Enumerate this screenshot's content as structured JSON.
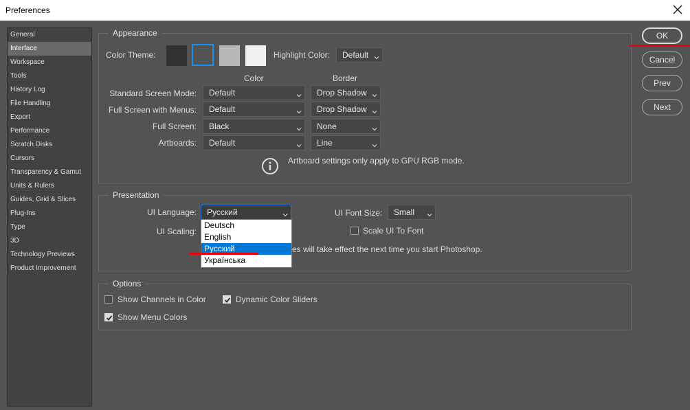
{
  "window": {
    "title": "Preferences"
  },
  "sidebar": {
    "items": [
      {
        "label": "General"
      },
      {
        "label": "Interface",
        "selected": true
      },
      {
        "label": "Workspace"
      },
      {
        "label": "Tools"
      },
      {
        "label": "History Log"
      },
      {
        "label": "File Handling"
      },
      {
        "label": "Export"
      },
      {
        "label": "Performance"
      },
      {
        "label": "Scratch Disks"
      },
      {
        "label": "Cursors"
      },
      {
        "label": "Transparency & Gamut"
      },
      {
        "label": "Units & Rulers"
      },
      {
        "label": "Guides, Grid & Slices"
      },
      {
        "label": "Plug-Ins"
      },
      {
        "label": "Type"
      },
      {
        "label": "3D"
      },
      {
        "label": "Technology Previews"
      },
      {
        "label": "Product Improvement"
      }
    ]
  },
  "appearance": {
    "title": "Appearance",
    "color_theme_label": "Color Theme:",
    "themes": [
      {
        "color": "#323232"
      },
      {
        "color": "#535353",
        "selected": true
      },
      {
        "color": "#b8b8b8"
      },
      {
        "color": "#f0f0f0"
      }
    ],
    "highlight_label": "Highlight Color:",
    "highlight_value": "Default",
    "color_header": "Color",
    "border_header": "Border",
    "rows": [
      {
        "label": "Standard Screen Mode:",
        "color": "Default",
        "border": "Drop Shadow"
      },
      {
        "label": "Full Screen with Menus:",
        "color": "Default",
        "border": "Drop Shadow"
      },
      {
        "label": "Full Screen:",
        "color": "Black",
        "border": "None"
      },
      {
        "label": "Artboards:",
        "color": "Default",
        "border": "Line"
      }
    ],
    "info_text": "Artboard settings only apply to GPU RGB mode."
  },
  "presentation": {
    "title": "Presentation",
    "ui_language_label": "UI Language:",
    "ui_language_value": "Русский",
    "ui_language_options": [
      {
        "label": "Deutsch"
      },
      {
        "label": "English"
      },
      {
        "label": "Русский",
        "selected": true
      },
      {
        "label": "Українська"
      }
    ],
    "ui_font_size_label": "UI Font Size:",
    "ui_font_size_value": "Small",
    "ui_scaling_label": "UI Scaling:",
    "scale_ui_to_font_label": "Scale UI To Font",
    "scale_ui_to_font_checked": false,
    "restart_note": "es will take effect the next time you start Photoshop."
  },
  "options": {
    "title": "Options",
    "show_channels": {
      "label": "Show Channels in Color",
      "checked": false
    },
    "dynamic_sliders": {
      "label": "Dynamic Color Sliders",
      "checked": true
    },
    "show_menu_colors": {
      "label": "Show Menu Colors",
      "checked": true
    }
  },
  "buttons": {
    "ok": "OK",
    "cancel": "Cancel",
    "prev": "Prev",
    "next": "Next"
  },
  "colors": {
    "accent": "#0078d7",
    "annotation_red": "#e8000b",
    "panel_bg": "#535353"
  }
}
